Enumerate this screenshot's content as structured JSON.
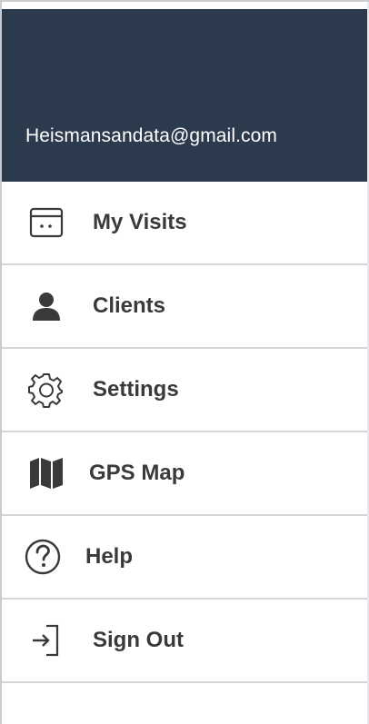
{
  "header": {
    "email": "Heismansandata@gmail.com"
  },
  "menu": {
    "items": [
      {
        "label": "My Visits",
        "icon": "calendar-icon"
      },
      {
        "label": "Clients",
        "icon": "person-icon"
      },
      {
        "label": "Settings",
        "icon": "gear-icon"
      },
      {
        "label": "GPS Map",
        "icon": "map-icon"
      },
      {
        "label": "Help",
        "icon": "help-circle-icon"
      },
      {
        "label": "Sign Out",
        "icon": "sign-out-icon"
      }
    ]
  },
  "colors": {
    "header_bg": "#2c3a4e",
    "text": "#3a3a3a",
    "divider": "#d3d6da"
  }
}
